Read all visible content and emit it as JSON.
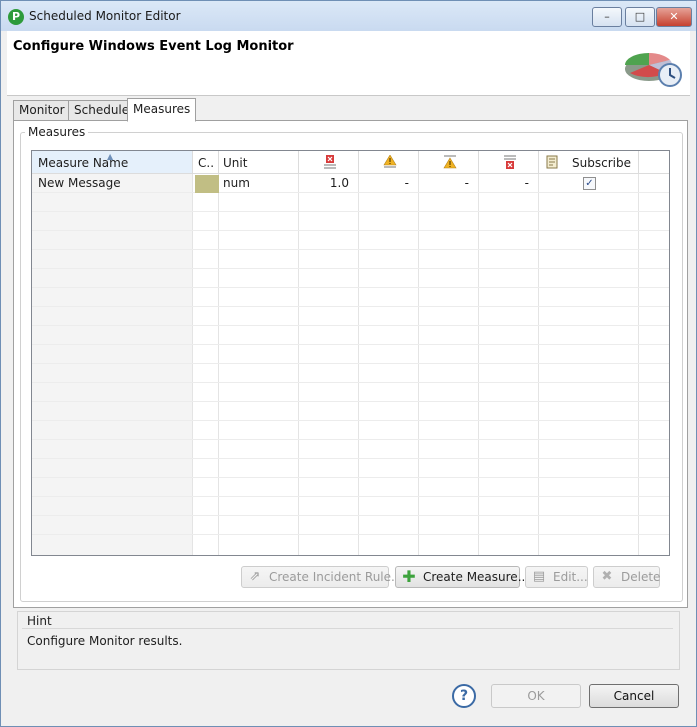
{
  "window": {
    "title": "Scheduled Monitor Editor",
    "controls": {
      "minimize": "–",
      "maximize": "□",
      "close": "✕"
    }
  },
  "header": {
    "title": "Configure Windows Event Log Monitor"
  },
  "tabs": [
    {
      "label": "Monitor",
      "active": false
    },
    {
      "label": "Schedule",
      "active": false
    },
    {
      "label": "Measures",
      "active": true
    }
  ],
  "measures": {
    "group_title": "Measures",
    "columns": {
      "name": "Measure Name",
      "color": "C..",
      "unit": "Unit",
      "subscribe": "Subscribe"
    },
    "rows": [
      {
        "name": "New Message",
        "color": "#c1be84",
        "unit": "num",
        "col1": "1.0",
        "col2": "-",
        "col3": "-",
        "col4": "-",
        "subscribed": true
      }
    ],
    "buttons": {
      "create_incident_rule": "Create Incident Rule...",
      "create_measure": "Create Measure...",
      "edit": "Edit...",
      "delete": "Delete"
    }
  },
  "hint": {
    "title": "Hint",
    "text": "Configure Monitor results."
  },
  "dialog": {
    "help": "?",
    "ok": "OK",
    "cancel": "Cancel"
  },
  "colors": {
    "accent": "#3b6aa5",
    "swatch": "#c1be84",
    "add_icon": "#3da33d",
    "delete_icon": "#b0b0b0"
  }
}
